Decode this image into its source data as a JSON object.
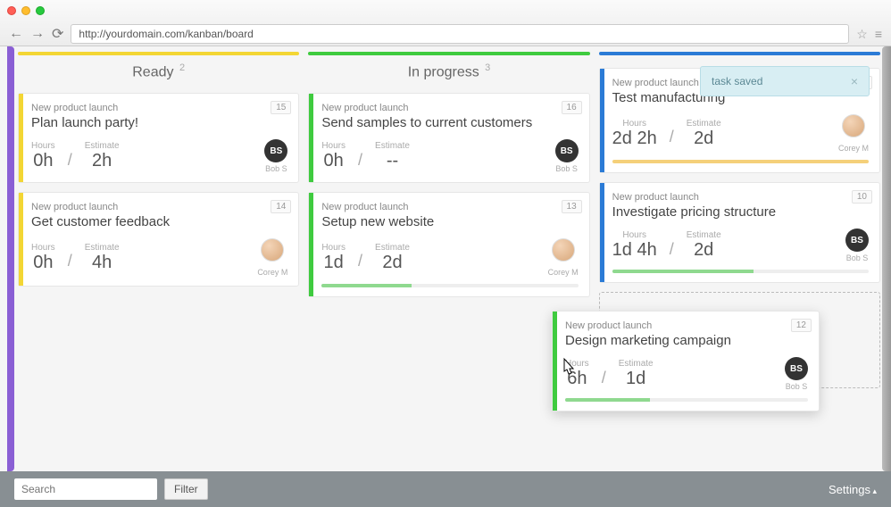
{
  "browser": {
    "url": "http://yourdomain.com/kanban/board"
  },
  "toast": {
    "text": "task saved"
  },
  "columns": [
    {
      "title": "Ready",
      "count": "2",
      "color": "yellow",
      "cards": [
        {
          "project": "New product launch",
          "title": "Plan launch party!",
          "num": "15",
          "hours_label": "Hours",
          "hours": "0h",
          "estimate_label": "Estimate",
          "estimate": "2h",
          "assignee": "Bob S",
          "avatar": "BS",
          "avatar_type": "bs"
        },
        {
          "project": "New product launch",
          "title": "Get customer feedback",
          "num": "14",
          "hours_label": "Hours",
          "hours": "0h",
          "estimate_label": "Estimate",
          "estimate": "4h",
          "assignee": "Corey M",
          "avatar": "",
          "avatar_type": "cm"
        }
      ]
    },
    {
      "title": "In progress",
      "count": "3",
      "color": "green",
      "cards": [
        {
          "project": "New product launch",
          "title": "Send samples to current customers",
          "num": "16",
          "hours_label": "Hours",
          "hours": "0h",
          "estimate_label": "Estimate",
          "estimate": "--",
          "assignee": "Bob S",
          "avatar": "BS",
          "avatar_type": "bs"
        },
        {
          "project": "New product launch",
          "title": "Setup new website",
          "num": "13",
          "hours_label": "Hours",
          "hours": "1d",
          "estimate_label": "Estimate",
          "estimate": "2d",
          "assignee": "Corey M",
          "avatar": "",
          "avatar_type": "cm",
          "progress": 35,
          "progress_color": "green"
        }
      ]
    },
    {
      "title": "",
      "count": "",
      "color": "blue",
      "cards": [
        {
          "project": "New product launch",
          "title": "Test manufacturing",
          "num": "11",
          "hours_label": "Hours",
          "hours": "2d 2h",
          "estimate_label": "Estimate",
          "estimate": "2d",
          "assignee": "Corey M",
          "avatar": "",
          "avatar_type": "cm",
          "progress": 100,
          "progress_color": "orange"
        },
        {
          "project": "New product launch",
          "title": "Investigate pricing structure",
          "num": "10",
          "hours_label": "Hours",
          "hours": "1d 4h",
          "estimate_label": "Estimate",
          "estimate": "2d",
          "assignee": "Bob S",
          "avatar": "BS",
          "avatar_type": "bs",
          "progress": 55,
          "progress_color": "green"
        }
      ],
      "dropzone": true
    }
  ],
  "drag_card": {
    "project": "New product launch",
    "title": "Design marketing campaign",
    "num": "12",
    "hours_label": "Hours",
    "hours": "6h",
    "estimate_label": "Estimate",
    "estimate": "1d",
    "assignee": "Bob S",
    "avatar": "BS",
    "avatar_type": "bs",
    "progress": 35,
    "progress_color": "green",
    "stripe": "green"
  },
  "footer": {
    "search_placeholder": "Search",
    "filter_label": "Filter",
    "settings_label": "Settings"
  }
}
